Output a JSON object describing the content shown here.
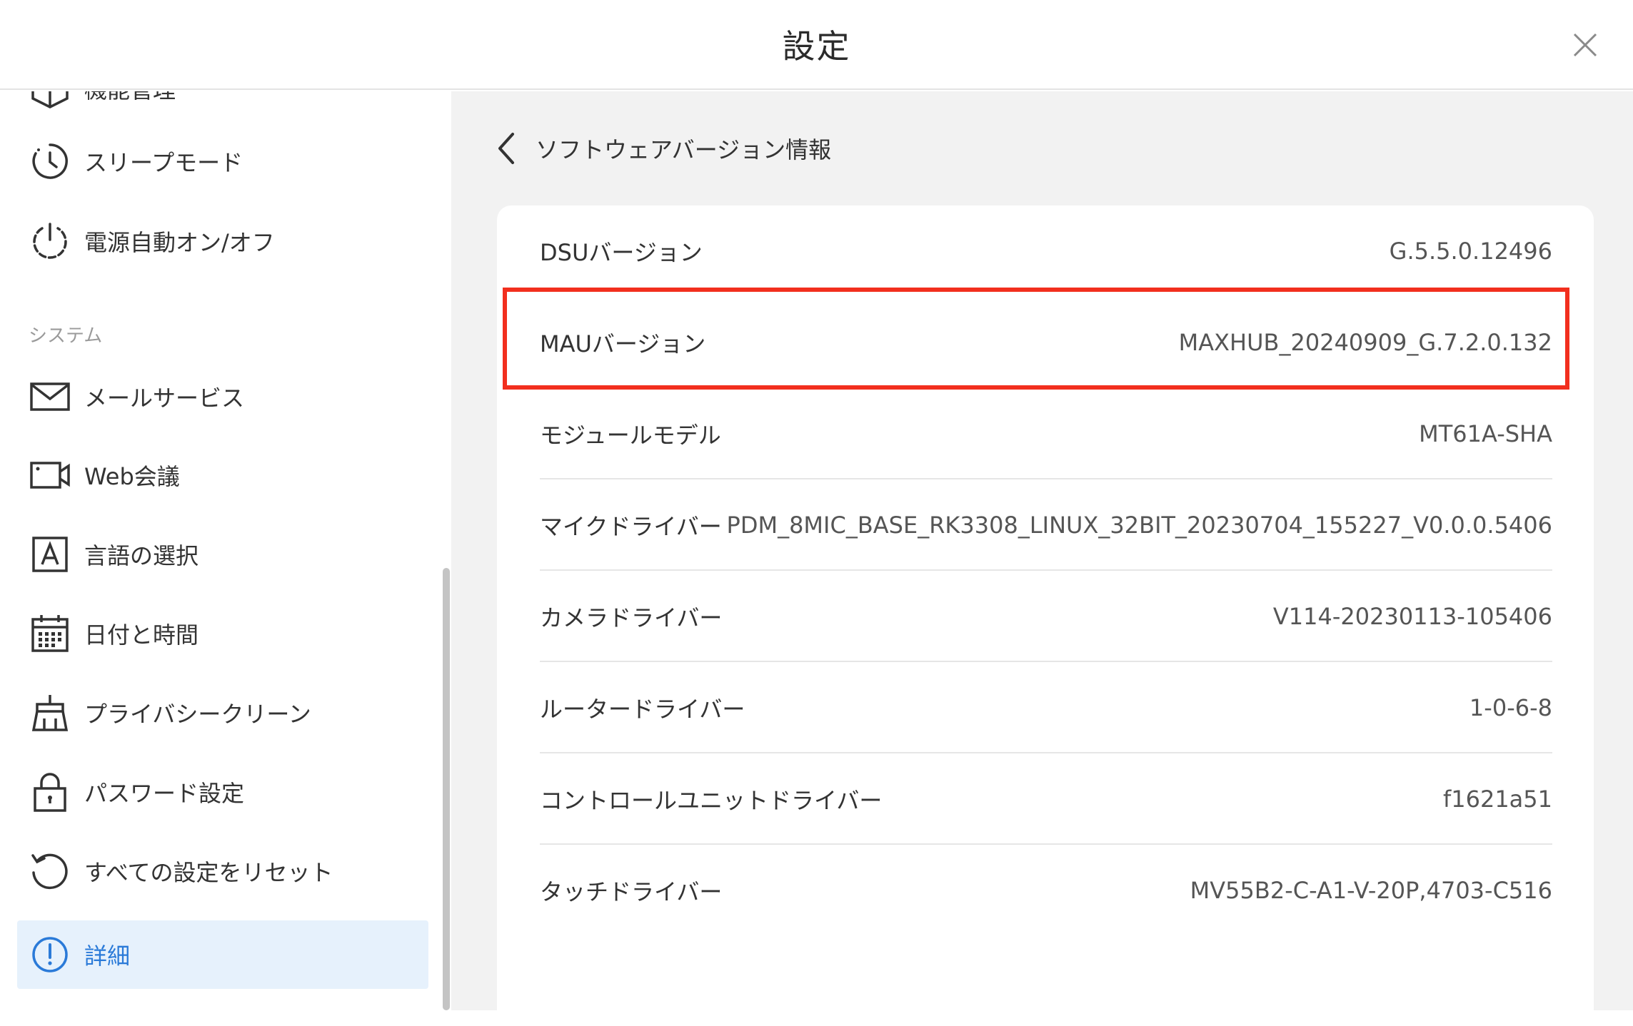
{
  "header": {
    "title": "設定"
  },
  "sidebar": {
    "clipped_item": {
      "label": "機能管理",
      "icon": "app-management-icon"
    },
    "items_top": [
      {
        "label": "スリープモード",
        "icon": "clock-icon"
      },
      {
        "label": "電源自動オン/オフ",
        "icon": "power-icon"
      }
    ],
    "section_label": "システム",
    "items": [
      {
        "label": "メールサービス",
        "icon": "mail-icon"
      },
      {
        "label": "Web会議",
        "icon": "video-camera-icon"
      },
      {
        "label": "言語の選択",
        "icon": "language-icon"
      },
      {
        "label": "日付と時間",
        "icon": "calendar-icon"
      },
      {
        "label": "プライバシークリーン",
        "icon": "broom-icon"
      },
      {
        "label": "パスワード設定",
        "icon": "lock-icon"
      },
      {
        "label": "すべての設定をリセット",
        "icon": "reset-icon"
      },
      {
        "label": "詳細",
        "icon": "info-icon",
        "active": true
      }
    ]
  },
  "content": {
    "back_label": "ソフトウェアバージョン情報",
    "rows": [
      {
        "key": "DSUバージョン",
        "value": "G.5.5.0.12496"
      },
      {
        "key": "MAUバージョン",
        "value": "MAXHUB_20240909_G.7.2.0.132",
        "highlighted": true
      },
      {
        "key": "モジュールモデル",
        "value": "MT61A-SHA"
      },
      {
        "key": "マイクドライバー",
        "value": "PDM_8MIC_BASE_RK3308_LINUX_32BIT_20230704_155227_V0.0.0.5406"
      },
      {
        "key": "カメラドライバー",
        "value": "V114-20230113-105406"
      },
      {
        "key": "ルータードライバー",
        "value": "1-0-6-8"
      },
      {
        "key": "コントロールユニットドライバー",
        "value": "f1621a51"
      },
      {
        "key": "タッチドライバー",
        "value": "MV55B2-C-A1-V-20P,4703-C516"
      }
    ]
  },
  "colors": {
    "accent": "#2a7ad8",
    "active_bg": "#e6f1fc",
    "highlight": "#f22f1e",
    "content_bg": "#f2f2f2"
  }
}
